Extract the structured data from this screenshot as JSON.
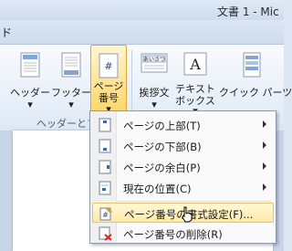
{
  "window": {
    "title": "文書 1 - Mic"
  },
  "tabs": {
    "visible_fragment": "ド"
  },
  "ribbon": {
    "buttons": [
      {
        "id": "header",
        "label": "ヘッダー",
        "arrow": "▾"
      },
      {
        "id": "footer",
        "label": "フッター",
        "arrow": "▾"
      },
      {
        "id": "page-number",
        "label_line1": "ページ",
        "label_line2": "番号",
        "arrow": "▾"
      },
      {
        "id": "greeting",
        "label": "挨拶文",
        "arrow": "▾"
      },
      {
        "id": "textbox",
        "label_line1": "テキスト",
        "label_line2": "ボックス",
        "arrow": "▾"
      },
      {
        "id": "quickparts",
        "label": "クイック パーツ"
      }
    ],
    "group_label": "ヘッダーとフッ"
  },
  "menu": {
    "items": [
      {
        "label": "ページの上部(T)",
        "icon": "page-top-icon",
        "submenu": true
      },
      {
        "label": "ページの下部(B)",
        "icon": "page-bottom-icon",
        "submenu": true
      },
      {
        "label": "ページの余白(P)",
        "icon": "page-margin-icon",
        "submenu": true
      },
      {
        "label": "現在の位置(C)",
        "icon": "current-position-icon",
        "submenu": true
      },
      {
        "label": "ページ番号の書式設定(F)...",
        "icon": "format-page-number-icon",
        "submenu": false,
        "hover": true
      },
      {
        "label": "ページ番号の削除(R)",
        "icon": "remove-page-number-icon",
        "submenu": false
      }
    ]
  },
  "colors": {
    "hover_fill": "#ffe9a6",
    "active_button": "#ffd665",
    "ribbon_bg": "#e6eef8"
  }
}
